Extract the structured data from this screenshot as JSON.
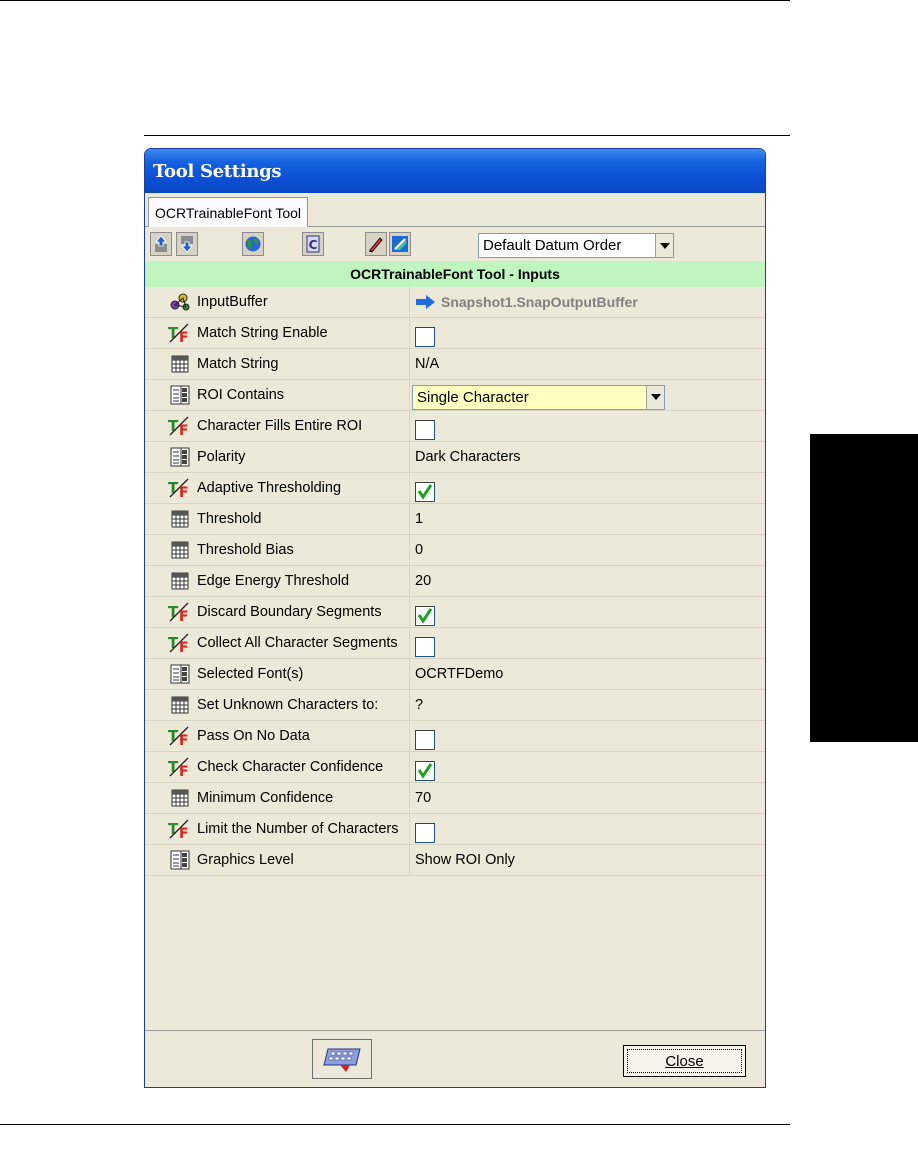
{
  "window": {
    "title": "Tool Settings"
  },
  "tabs": [
    {
      "label": "OCRTrainableFont Tool"
    }
  ],
  "toolbar": {
    "datum_order": "Default Datum Order",
    "icons": [
      "move-up-icon",
      "move-down-icon",
      "globe-icon",
      "calculator-icon",
      "edit-pencil-icon",
      "image-link-icon"
    ]
  },
  "section": {
    "title": "OCRTrainableFont Tool - Inputs"
  },
  "rows": [
    {
      "label": "InputBuffer",
      "icon": "buffer-link-icon",
      "kind": "link",
      "value": "Snapshot1.SnapOutputBuffer"
    },
    {
      "label": "Match String Enable",
      "icon": "true-false-icon",
      "kind": "check",
      "checked": false
    },
    {
      "label": "Match String",
      "icon": "keypad-icon",
      "kind": "text",
      "value": "N/A"
    },
    {
      "label": "ROI Contains",
      "icon": "list-select-icon",
      "kind": "combo",
      "value": "Single Character"
    },
    {
      "label": "Character Fills Entire ROI",
      "icon": "true-false-icon",
      "kind": "check",
      "checked": false
    },
    {
      "label": "Polarity",
      "icon": "list-select-icon",
      "kind": "text",
      "value": "Dark Characters"
    },
    {
      "label": "Adaptive Thresholding",
      "icon": "true-false-icon",
      "kind": "check",
      "checked": true
    },
    {
      "label": "Threshold",
      "icon": "keypad-icon",
      "kind": "text",
      "value": "1"
    },
    {
      "label": "Threshold Bias",
      "icon": "keypad-icon",
      "kind": "text",
      "value": "0"
    },
    {
      "label": "Edge Energy Threshold",
      "icon": "keypad-icon",
      "kind": "text",
      "value": "20"
    },
    {
      "label": "Discard Boundary Segments",
      "icon": "true-false-icon",
      "kind": "check",
      "checked": true
    },
    {
      "label": "Collect All Character Segments",
      "icon": "true-false-icon",
      "kind": "check",
      "checked": false
    },
    {
      "label": "Selected Font(s)",
      "icon": "list-select-icon",
      "kind": "text",
      "value": "OCRTFDemo"
    },
    {
      "label": "Set Unknown Characters to:",
      "icon": "keypad-icon",
      "kind": "text",
      "value": "?"
    },
    {
      "label": "Pass On No Data",
      "icon": "true-false-icon",
      "kind": "check",
      "checked": false
    },
    {
      "label": "Check Character Confidence",
      "icon": "true-false-icon",
      "kind": "check",
      "checked": true
    },
    {
      "label": "Minimum Confidence",
      "icon": "keypad-icon",
      "kind": "text",
      "value": "70"
    },
    {
      "label": "Limit the Number of Characters",
      "icon": "true-false-icon",
      "kind": "check",
      "checked": false
    },
    {
      "label": "Graphics Level",
      "icon": "list-select-icon",
      "kind": "text",
      "value": "Show ROI Only"
    }
  ],
  "footer": {
    "close_label": "Close",
    "keyboard_icon": "keyboard-icon"
  },
  "colors": {
    "title_bar": "#0b4fd2",
    "section_header": "#c0f5c0",
    "combo_highlight": "#ffffc0",
    "check_mark": "#21a121"
  }
}
